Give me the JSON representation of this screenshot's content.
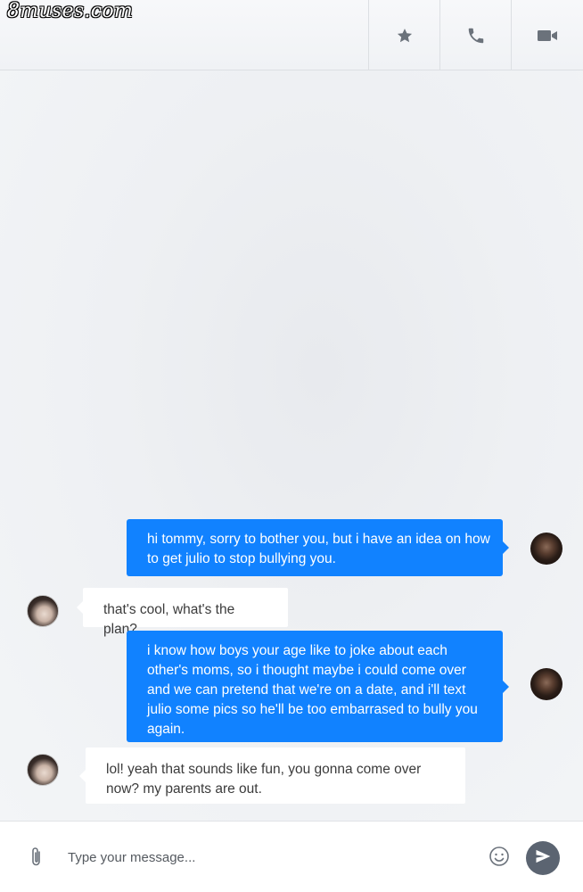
{
  "watermark": "8muses.com",
  "header": {
    "actions": [
      {
        "icon": "star-icon"
      },
      {
        "icon": "phone-icon"
      },
      {
        "icon": "video-camera-icon"
      }
    ]
  },
  "messages": [
    {
      "direction": "outgoing",
      "text": "hi tommy, sorry to bother you, but i have an idea on how to get julio to stop bullying you."
    },
    {
      "direction": "incoming",
      "text": "that's cool, what's the plan?"
    },
    {
      "direction": "outgoing",
      "text": "i know how boys your age like to joke about each other's moms, so i thought maybe i could come over and we can pretend that we're on a date, and i'll text julio some pics so he'll be too embarrased to bully you again."
    },
    {
      "direction": "incoming",
      "text": "lol! yeah that sounds like fun, you gonna come over now? my parents are out."
    }
  ],
  "composer": {
    "placeholder": "Type your message...",
    "value": ""
  },
  "colors": {
    "outgoing_bubble": "#1182ff",
    "incoming_bubble": "#ffffff",
    "send_button": "#5b6471"
  }
}
